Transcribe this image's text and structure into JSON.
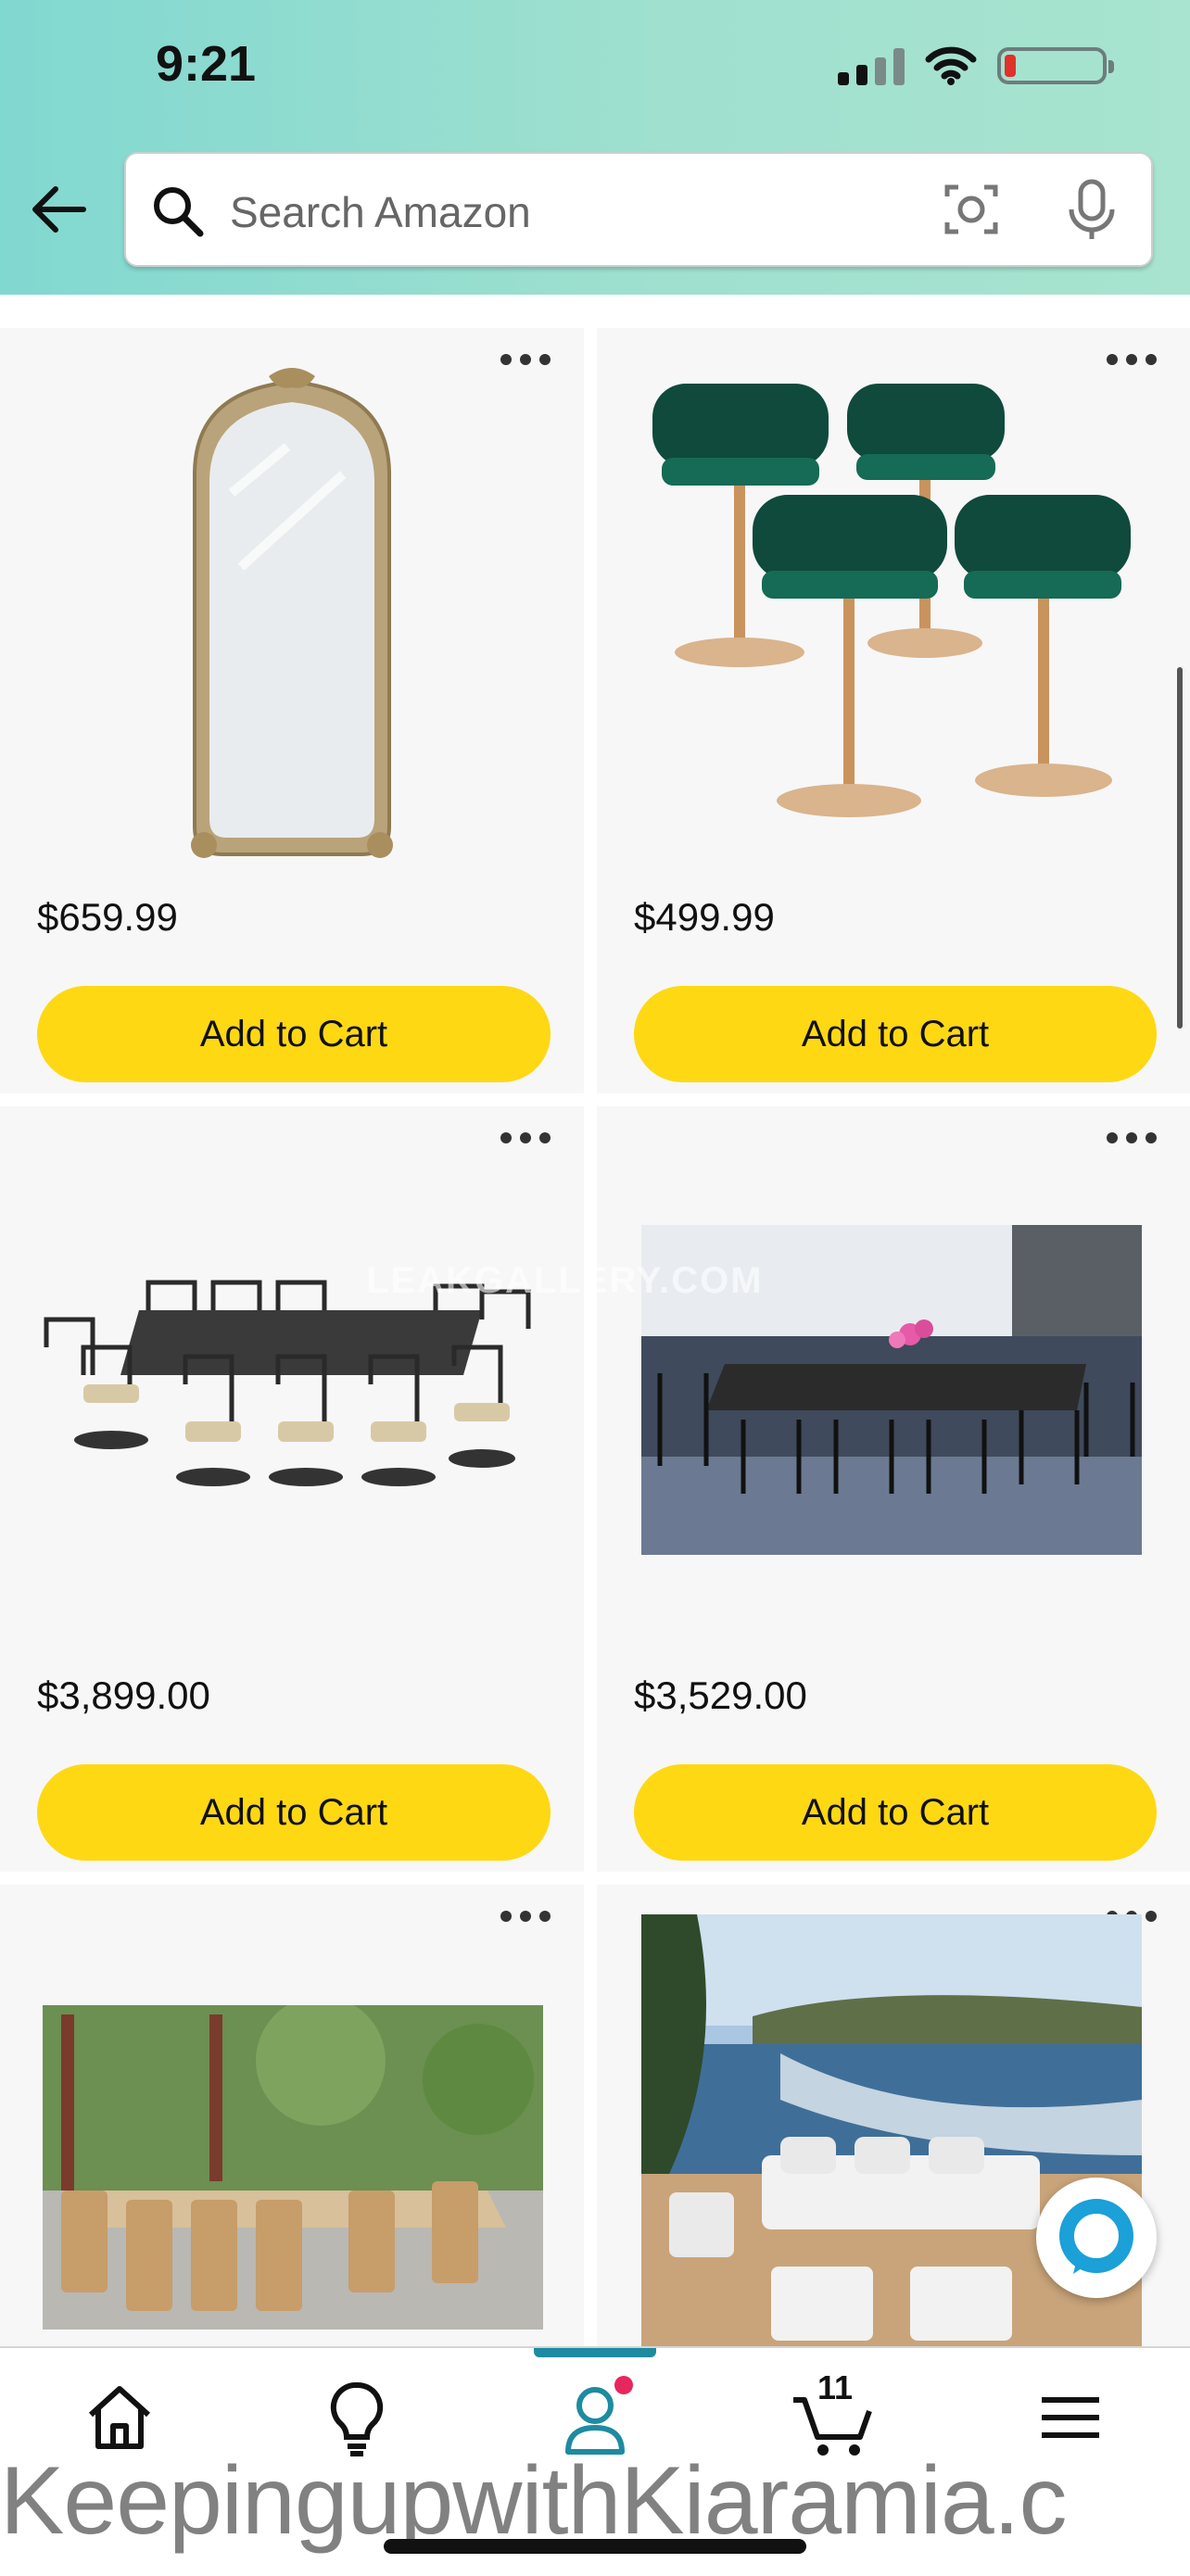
{
  "status_bar": {
    "time": "9:21"
  },
  "search": {
    "placeholder": "Search Amazon"
  },
  "products": [
    {
      "price": "$659.99",
      "button": "Add to Cart",
      "image": "gold-arched-floor-mirror"
    },
    {
      "price": "$499.99",
      "button": "Add to Cart",
      "image": "green-velvet-bar-stools-set-of-4"
    },
    {
      "price": "$3,899.00",
      "button": "Add to Cart",
      "image": "cast-aluminum-patio-dining-set"
    },
    {
      "price": "$3,529.00",
      "button": "Add to Cart",
      "image": "outdoor-patio-dining-table-photo"
    },
    {
      "image": "teak-outdoor-dining-set-photo"
    },
    {
      "image": "outdoor-sectional-sofa-by-sea-photo"
    }
  ],
  "watermarks": {
    "middle": "LEAKGALLERY.COM",
    "bottom": "KeepingupwithKiaramia.c"
  },
  "bottom_nav": {
    "items": [
      "home-icon",
      "inspire-bulb-icon",
      "account-icon",
      "cart-icon",
      "menu-icon"
    ],
    "active": "account-icon",
    "cart_count": "11"
  },
  "colors": {
    "accent": "#1d8ba1",
    "button": "#ffd814",
    "header_start": "#81d8d0",
    "notification": "#e8265e"
  }
}
